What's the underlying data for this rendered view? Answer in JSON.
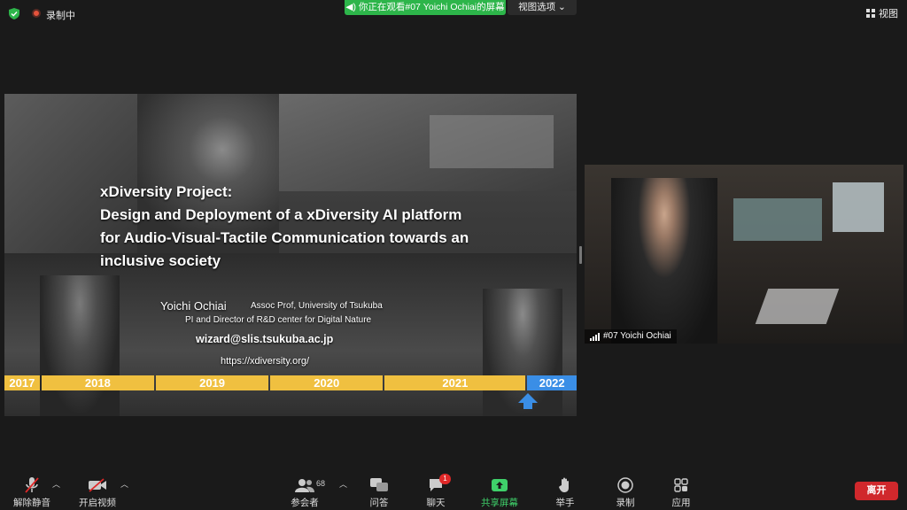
{
  "topbar": {
    "recording_label": "录制中",
    "share_banner": "你正在观看#07 Yoichi Ochiai的屏幕",
    "view_options": "视图选项",
    "view_button": "视图",
    "colors": {
      "share_green": "#2db54a",
      "record_red": "#e5533c"
    }
  },
  "slide": {
    "title_lines": [
      "xDiversity Project:",
      "Design and Deployment of a xDiversity AI platform",
      "for Audio-Visual-Tactile Communication towards an",
      "inclusive society"
    ],
    "author": "Yoichi Ochiai",
    "affiliation_1": "Assoc Prof, University of Tsukuba",
    "affiliation_2": "PI and Director of R&D center for Digital Nature",
    "email": "wizard@slis.tsukuba.ac.jp",
    "url": "https://xdiversity.org/",
    "timeline": [
      "2017",
      "2018",
      "2019",
      "2020",
      "2021",
      "2022"
    ],
    "current_year_color": "#3a8ee6",
    "timeline_color": "#f0c040"
  },
  "participant": {
    "name": "#07 Yoichi Ochiai"
  },
  "toolbar": {
    "mute": "解除静音",
    "video": "开启视频",
    "participants": "参会者",
    "participants_count": "68",
    "qa": "问答",
    "chat": "聊天",
    "chat_badge": "1",
    "share": "共享屏幕",
    "raise_hand": "举手",
    "record": "录制",
    "apps": "应用",
    "leave": "离开",
    "leave_color": "#d0282c"
  }
}
